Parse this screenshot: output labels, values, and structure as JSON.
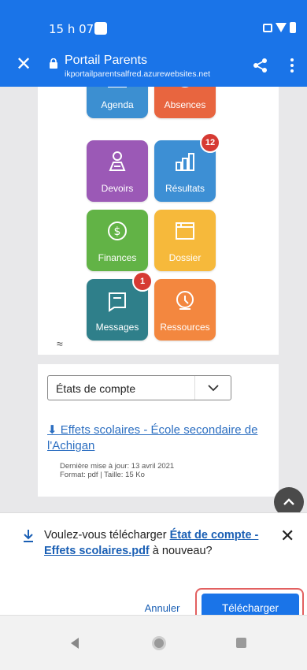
{
  "status_bar": {
    "time": "15 h 07"
  },
  "browser": {
    "title": "Portail Parents",
    "host": "ikportailparentsalfred.azurewebsites.net"
  },
  "tiles": [
    {
      "label": "Agenda",
      "color": "#3c8fd1"
    },
    {
      "label": "Absences",
      "color": "#e8653f"
    },
    {
      "label": "Devoirs",
      "color": "#9b59b6"
    },
    {
      "label": "Résultats",
      "color": "#3d8fd4",
      "badge": "12"
    },
    {
      "label": "Finances",
      "color": "#62b346"
    },
    {
      "label": "Dossier",
      "color": "#f6b93b"
    },
    {
      "label": "Messages",
      "color": "#2f7f8a",
      "badge": "1"
    },
    {
      "label": "Ressources",
      "color": "#f3873f"
    }
  ],
  "collapse_symbol": "≈",
  "account_select": {
    "value": "États de compte"
  },
  "document": {
    "title": "⬇ Effets scolaires - École secondaire de l'Achigan",
    "updated": "Dernière mise à jour: 13 avril 2021",
    "format": "Format: pdf | Taille: 15 Ko"
  },
  "download_prompt": {
    "text_before": "Voulez-vous télécharger ",
    "file_link": "État de compte - Effets scolaires.pdf",
    "text_after": " à nouveau?",
    "cancel_label": "Annuler",
    "download_label": "Télécharger"
  },
  "colors": {
    "accent": "#1a74e8",
    "badge": "#d63a33",
    "highlight_frame": "#e26060"
  }
}
